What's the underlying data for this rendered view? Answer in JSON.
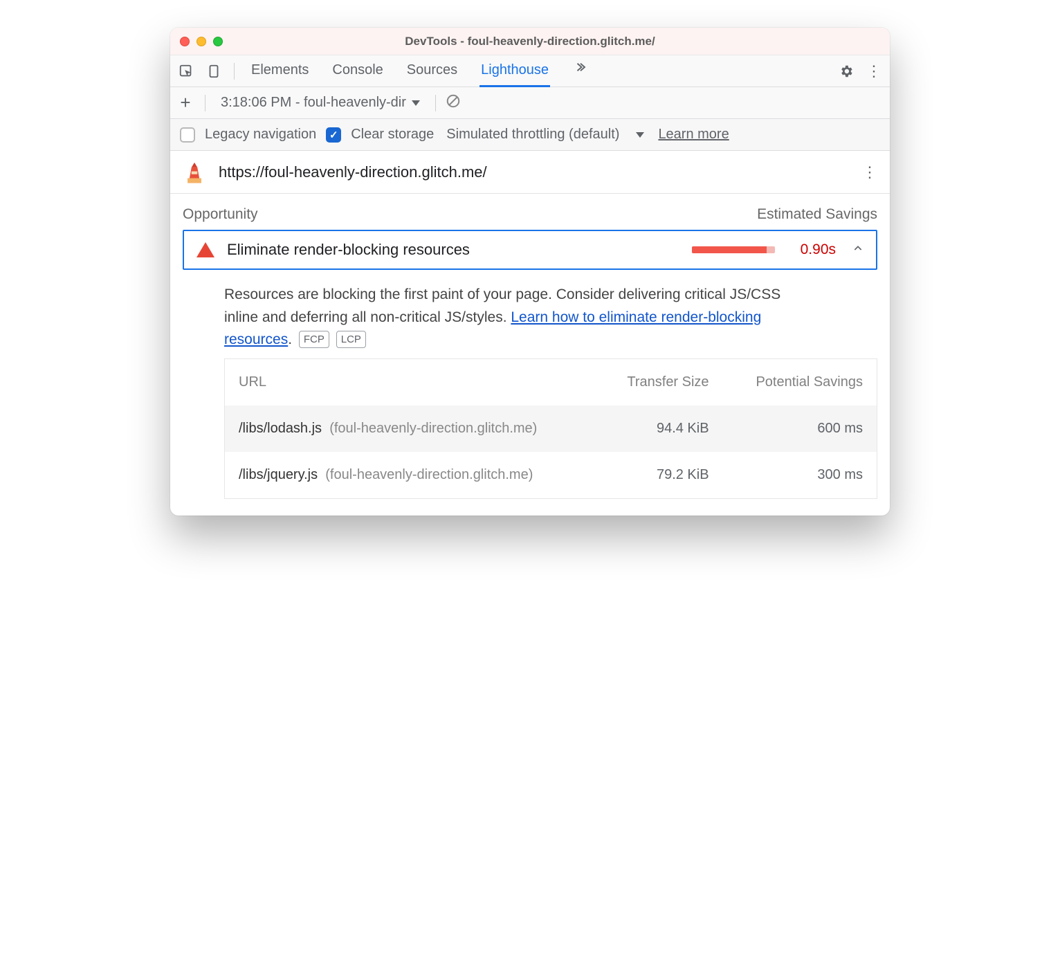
{
  "window": {
    "title": "DevTools - foul-heavenly-direction.glitch.me/"
  },
  "tabs": [
    "Elements",
    "Console",
    "Sources",
    "Lighthouse"
  ],
  "active_tab": "Lighthouse",
  "toolbar": {
    "report_label": "3:18:06 PM - foul-heavenly-dir"
  },
  "options": {
    "legacy_label": "Legacy navigation",
    "legacy_checked": false,
    "clear_label": "Clear storage",
    "clear_checked": true,
    "throttling_label": "Simulated throttling (default)",
    "learn_more": "Learn more"
  },
  "page": {
    "url": "https://foul-heavenly-direction.glitch.me/"
  },
  "columns": {
    "opportunity": "Opportunity",
    "savings": "Estimated Savings"
  },
  "opportunity": {
    "title": "Eliminate render-blocking resources",
    "value": "0.90s",
    "bar_pct": 90,
    "description_a": "Resources are blocking the first paint of your page. Consider delivering critical JS/CSS inline and deferring all non-critical JS/styles. ",
    "link_text": "Learn how to eliminate render-blocking resources",
    "description_b": ".",
    "badges": [
      "FCP",
      "LCP"
    ]
  },
  "table": {
    "headers": {
      "url": "URL",
      "size": "Transfer Size",
      "savings": "Potential Savings"
    },
    "rows": [
      {
        "path": "/libs/lodash.js",
        "host": "(foul-heavenly-direction.glitch.me)",
        "size": "94.4 KiB",
        "savings": "600 ms"
      },
      {
        "path": "/libs/jquery.js",
        "host": "(foul-heavenly-direction.glitch.me)",
        "size": "79.2 KiB",
        "savings": "300 ms"
      }
    ]
  }
}
